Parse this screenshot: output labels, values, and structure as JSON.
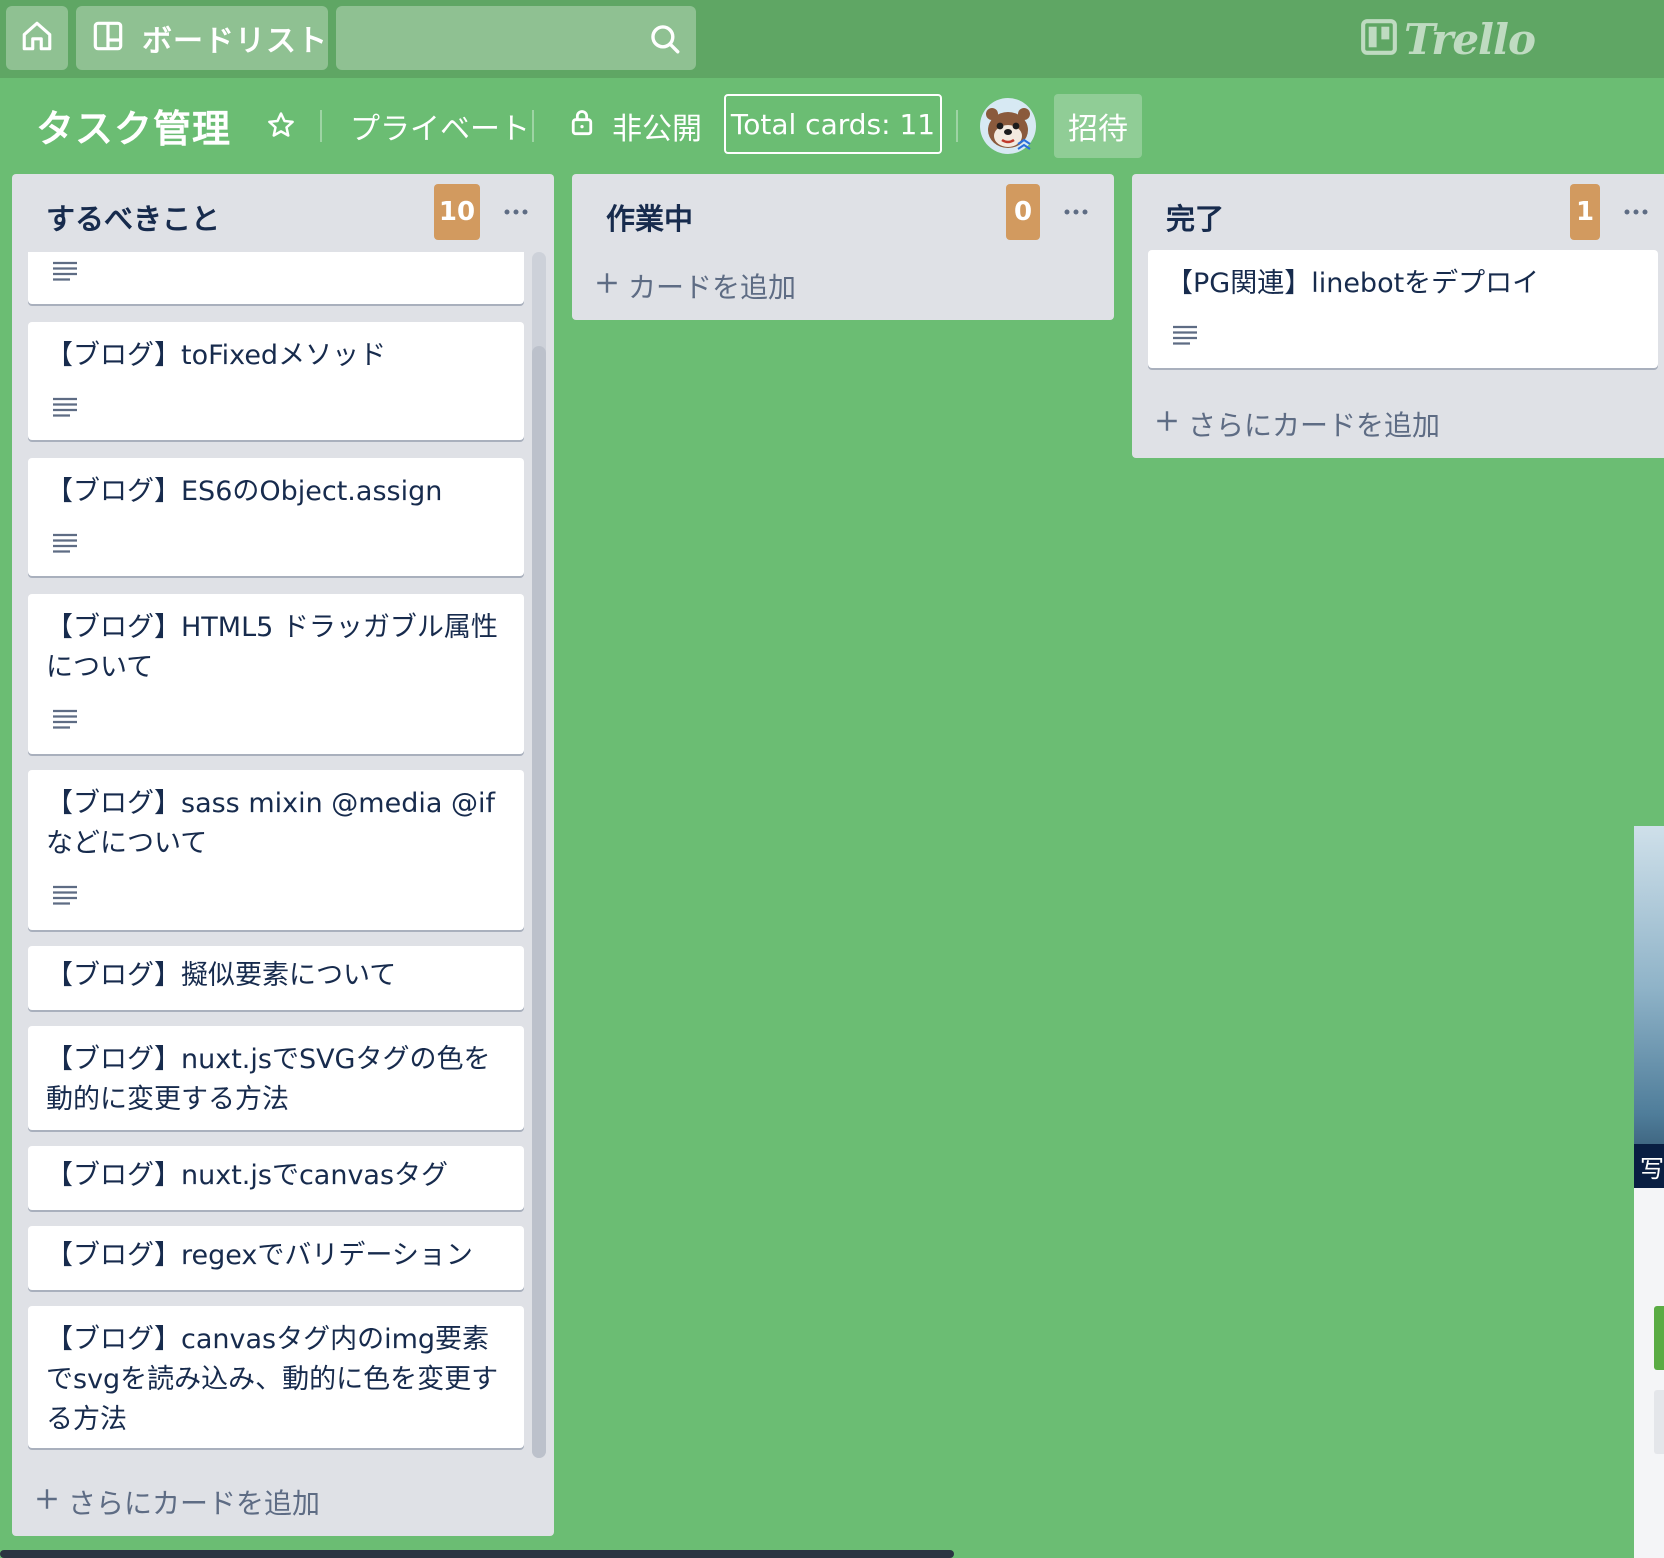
{
  "nav": {
    "boards_label": "ボードリスト",
    "search": {
      "value": "",
      "placeholder": ""
    },
    "logo_text": "Trello"
  },
  "board": {
    "title": "タスク管理",
    "visibility_private": "プライベート",
    "visibility_closed": "非公開",
    "total_cards": "Total cards: 11",
    "invite_label": "招待"
  },
  "lists": [
    {
      "title": "するべきこと",
      "count": "10",
      "cards": [
        {
          "title": ""
        },
        {
          "title": "【ブログ】toFixedメソッド"
        },
        {
          "title": "【ブログ】ES6のObject.assign"
        },
        {
          "title": "【ブログ】HTML5 ドラッガブル属性について"
        },
        {
          "title": "【ブログ】sass mixin @media @ifなどについて"
        },
        {
          "title": "【ブログ】擬似要素について"
        },
        {
          "title": "【ブログ】nuxt.jsでSVGタグの色を動的に変更する方法"
        },
        {
          "title": "【ブログ】nuxt.jsでcanvasタグ"
        },
        {
          "title": "【ブログ】regexでバリデーション"
        },
        {
          "title": "【ブログ】canvasタグ内のimg要素でsvgを読み込み、動的に色を変更する方法"
        }
      ],
      "add_label": "さらにカードを追加"
    },
    {
      "title": "作業中",
      "count": "0",
      "cards": [],
      "add_label": "カードを追加"
    },
    {
      "title": "完了",
      "count": "1",
      "cards": [
        {
          "title": "【PG関連】linebotをデプロイ"
        }
      ],
      "add_label": "さらにカードを追加"
    }
  ],
  "side_peek": {
    "label": "写"
  },
  "colors": {
    "board_bg": "#6bbd73",
    "topbar_bg": "#5fa664",
    "count_badge": "#d29a5f",
    "list_bg": "#dfe1e6"
  },
  "icons": [
    "home-icon",
    "board-icon",
    "search-icon",
    "trello-logo-icon",
    "star-icon",
    "lock-icon",
    "ellipsis-icon",
    "description-icon",
    "plus-icon"
  ]
}
